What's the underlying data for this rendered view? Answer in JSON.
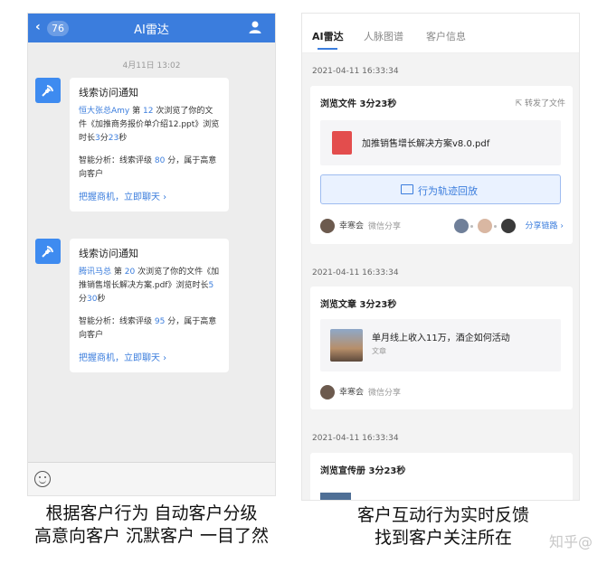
{
  "left_phone": {
    "nav": {
      "back_count": "76",
      "title": "AI雷达"
    },
    "timestamp": "4月11日 13:02",
    "messages": [
      {
        "title": "线索访问通知",
        "name": "恒大张总Amy",
        "text1": " 第 ",
        "count": "12",
        "text2": " 次浏览了你的文件《加推商务报价单介绍12.ppt》浏览时长",
        "d1": "3",
        "u1": "分",
        "d2": "23",
        "u2": "秒",
        "analysis_prefix": "智能分析：线索评级 ",
        "score": "80",
        "analysis_suffix": " 分，属于高意向客户",
        "link": "把握商机，立即聊天 ›"
      },
      {
        "title": "线索访问通知",
        "name": "腾讯马总",
        "text1": " 第 ",
        "count": "20",
        "text2": " 次浏览了你的文件《加推销售增长解决方案.pdf》浏览时长",
        "d1": "5",
        "u1": "分",
        "d2": "30",
        "u2": "秒",
        "analysis_prefix": "智能分析：线索评级 ",
        "score": "95",
        "analysis_suffix": " 分，属于高意向客户",
        "link": "把握商机，立即聊天 ›"
      }
    ],
    "caption_line1": "根据客户行为 自动客户分级",
    "caption_line2": "高意向客户 沉默客户 一目了然"
  },
  "right_phone": {
    "tabs": [
      "AI雷达",
      "人脉图谱",
      "客户信息"
    ],
    "entries": [
      {
        "date": "2021-04-11 16:33:34",
        "title": "浏览文件  3分23秒",
        "right_link": "转发了文件",
        "file_name": "加推销售增长解决方案v8.0.pdf",
        "button": "行为轨迹回放",
        "person": "幸寒会",
        "via": "微信分享",
        "chain": "分享链路 ›"
      },
      {
        "date": "2021-04-11 16:33:34",
        "title": "浏览文章  3分23秒",
        "article_title": "单月线上收入11万，酒企如何活动",
        "article_sub": "文章",
        "person": "幸寒会",
        "via": "微信分享"
      },
      {
        "date": "2021-04-11 16:33:34",
        "title": "浏览宣传册  3分23秒"
      }
    ],
    "caption_line1": "客户互动行为实时反馈",
    "caption_line2": "找到客户关注所在"
  },
  "watermark": "知乎@",
  "colors": {
    "accent": "#3b7ddd",
    "radar": "#3e8bf0",
    "pdf": "#e34d4d"
  }
}
